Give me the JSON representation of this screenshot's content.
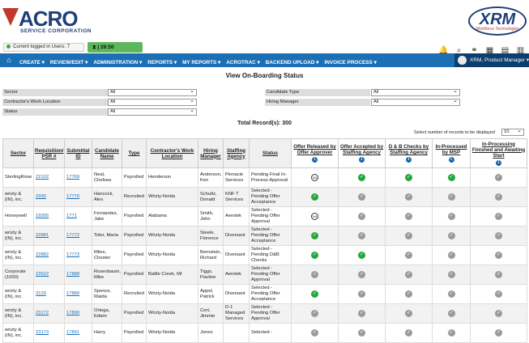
{
  "header": {
    "acro_logo": "ACRO",
    "acro_sub": "SERVICE CORPORATION",
    "xrm_logo": "XRM",
    "xrm_sub": "Workforce Technologies"
  },
  "status": {
    "users": "Current logged in Users: 7",
    "timer": "28:50"
  },
  "top_icons": [
    "bell-icon",
    "search-icon",
    "link-icon",
    "calendar-icon",
    "calendar-alt-icon",
    "grid-icon"
  ],
  "nav": {
    "items": [
      "CREATE ▾",
      "REVIEW/EDIT ▾",
      "ADMINISTRATION ▾",
      "REPORTS ▾",
      "MY REPORTS ▾",
      "ACROTRAC ▾",
      "BACKEND UPLOAD ▾",
      "INVOICE PROCESS ▾"
    ],
    "user": "XRM, Product Manager ▾"
  },
  "page_title": "View On-Boarding Status",
  "filters": {
    "sector_label": "Sector",
    "sector_value": "All",
    "location_label": "Contractor's Work Location",
    "location_value": "All",
    "status_label": "Status",
    "status_value": "All",
    "candidate_type_label": "Candidate Type",
    "candidate_type_value": "All",
    "hiring_manager_label": "Hiring Manager",
    "hiring_manager_value": "All"
  },
  "total_records": "Total Record(s): 300",
  "per_page_label": "Select number of records to be displayed",
  "per_page_value": "10",
  "columns": [
    "Sector",
    "Requisition/ PSR #",
    "Submittal ID",
    "Candidate Name",
    "Type",
    "Contractor's Work Location",
    "Hiring Manager",
    "Staffing Agency",
    "Status",
    "Offer Released by Offer Approver",
    "Offer Accepted by Staffing Agency",
    "D & B Checks by Staffing Agency",
    "In-Processed by MSP",
    "In-Processing Finished and Awaiting Start"
  ],
  "rows": [
    {
      "sector": "SterlingRose",
      "req": "22102",
      "sub": "17769",
      "name": "Neal, Chelsea",
      "type": "Payrolled",
      "loc": "Henderson",
      "mgr": "Anderson, Ken",
      "agency": "Pinnacle Services",
      "status": "Pending Final In-Process Approval",
      "steps": [
        "na",
        "green",
        "green",
        "green",
        "gray"
      ]
    },
    {
      "sector": "wrizty & (IN), inc.",
      "req": "2930",
      "sub": "17770",
      "name": "Hancock, Alex",
      "type": "Recruited",
      "loc": "Wrizty-Noida",
      "mgr": "Schultz, Donald",
      "agency": "KNF T Services",
      "status": "Selected - Pending Offer Acceptance",
      "steps": [
        "green",
        "gray",
        "gray",
        "gray",
        "gray"
      ]
    },
    {
      "sector": "Honeywell",
      "req": "19305",
      "sub": "1771",
      "name": "Fernandez, Jake",
      "type": "Payrolled",
      "loc": "Alabama",
      "mgr": "Smith, John",
      "agency": "Aerotek",
      "status": "Selected - Pending Offer Approval",
      "steps": [
        "na",
        "gray",
        "gray",
        "gray",
        "gray"
      ]
    },
    {
      "sector": "wrizty & (IN), inc.",
      "req": "22881",
      "sub": "17772",
      "name": "Toler, Maria",
      "type": "Payrolled",
      "loc": "Wrizty-Noida",
      "mgr": "Steele, Florence",
      "agency": "Diversant",
      "status": "Selected - Pending Offer Acceptance",
      "steps": [
        "green",
        "gray",
        "gray",
        "gray",
        "gray"
      ]
    },
    {
      "sector": "wrizty & (IN), inc.",
      "req": "22882",
      "sub": "17773",
      "name": "Miles, Chester",
      "type": "Payrolled",
      "loc": "Wrizty-Noida",
      "mgr": "Bernstein, Richard",
      "agency": "Diversant",
      "status": "Selected - Pending D&B Checks",
      "steps": [
        "green",
        "green",
        "gray",
        "gray",
        "gray"
      ]
    },
    {
      "sector": "Corporate (1000)",
      "req": "22622",
      "sub": "17888",
      "name": "Rosenbaum, Mike",
      "type": "Payrolled",
      "loc": "Battle Creek, MI",
      "mgr": "Tiggs, Pauline",
      "agency": "Aerotek",
      "status": "Selected - Pending Offer Approval",
      "steps": [
        "gray",
        "gray",
        "gray",
        "gray",
        "gray"
      ]
    },
    {
      "sector": "wrizty & (IN), inc.",
      "req": "3129",
      "sub": "17889",
      "name": "Spence, Maida",
      "type": "Recruited",
      "loc": "Wrizty-Noida",
      "mgr": "Appel, Patrick",
      "agency": "Diversant",
      "status": "Selected - Pending Offer Acceptance",
      "steps": [
        "green",
        "gray",
        "gray",
        "gray",
        "gray"
      ]
    },
    {
      "sector": "wrizty & (IN), inc.",
      "req": "23172",
      "sub": "17890",
      "name": "Ortega, Edwin",
      "type": "Payrolled",
      "loc": "Wrizty-Noida",
      "mgr": "Cort, Jimmie",
      "agency": "D-1 Managed Services",
      "status": "Selected - Pending Offer Approval",
      "steps": [
        "gray",
        "gray",
        "gray",
        "gray",
        "gray"
      ]
    },
    {
      "sector": "wrizty & (IN), inc.",
      "req": "23173",
      "sub": "17891",
      "name": "Harry",
      "type": "Payrolled",
      "loc": "Wrizty-Noida",
      "mgr": "Jones",
      "agency": "",
      "status": "Selected -",
      "steps": [
        "gray",
        "gray",
        "gray",
        "gray",
        "gray"
      ]
    }
  ]
}
